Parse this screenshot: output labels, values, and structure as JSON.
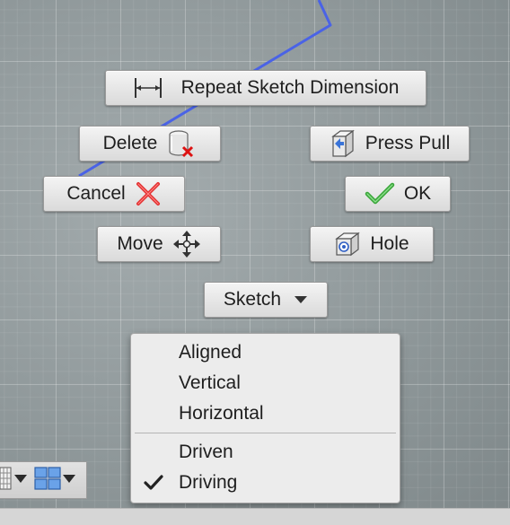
{
  "marking_menu": {
    "repeat_sketch_dimension": {
      "label": "Repeat Sketch Dimension",
      "icon": "dimension-icon"
    },
    "delete": {
      "label": "Delete",
      "icon": "delete-icon"
    },
    "press_pull": {
      "label": "Press Pull",
      "icon": "press-pull-icon"
    },
    "cancel": {
      "label": "Cancel",
      "icon": "red-x-icon"
    },
    "ok": {
      "label": "OK",
      "icon": "green-check-icon"
    },
    "move": {
      "label": "Move",
      "icon": "move-icon"
    },
    "hole": {
      "label": "Hole",
      "icon": "hole-icon"
    },
    "sketch": {
      "label": "Sketch",
      "icon": "dropdown-arrow-icon"
    }
  },
  "sketch_dropdown": {
    "items": [
      {
        "label": "Aligned",
        "checked": false
      },
      {
        "label": "Vertical",
        "checked": false
      },
      {
        "label": "Horizontal",
        "checked": false
      },
      {
        "label": "Driven",
        "checked": false
      },
      {
        "label": "Driving",
        "checked": true
      }
    ]
  },
  "view_toolbar": {
    "items": [
      {
        "icon": "grid-display-icon"
      },
      {
        "icon": "viewports-icon"
      }
    ]
  },
  "colors": {
    "sketch_line": "#4a63e6",
    "cancel_icon": "#e23030",
    "ok_icon": "#3aa63a"
  }
}
